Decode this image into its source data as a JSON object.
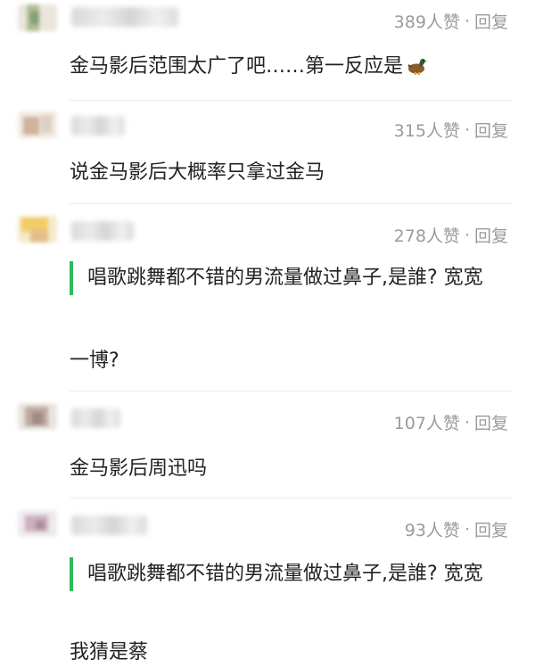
{
  "comments": [
    {
      "likes": "389人赞",
      "dot": "·",
      "reply": "回复",
      "text": "金马影后范围太广了吧……第一反应是",
      "emoji": "duck"
    },
    {
      "likes": "315人赞",
      "dot": "·",
      "reply": "回复",
      "text": "说金马影后大概率只拿过金马"
    },
    {
      "likes": "278人赞",
      "dot": "·",
      "reply": "回复",
      "quote": "唱歌跳舞都不错的男流量做过鼻子,是誰? 宽宽",
      "text": "一博?"
    },
    {
      "likes": "107人赞",
      "dot": "·",
      "reply": "回复",
      "text": "金马影后周迅吗"
    },
    {
      "likes": "93人赞",
      "dot": "·",
      "reply": "回复",
      "quote": "唱歌跳舞都不错的男流量做过鼻子,是誰? 宽宽",
      "text": "我猜是蔡"
    }
  ],
  "colors": {
    "quote_bar": "#2dbb5a",
    "meta_text": "#9b9b9b",
    "body_text": "#222222"
  }
}
